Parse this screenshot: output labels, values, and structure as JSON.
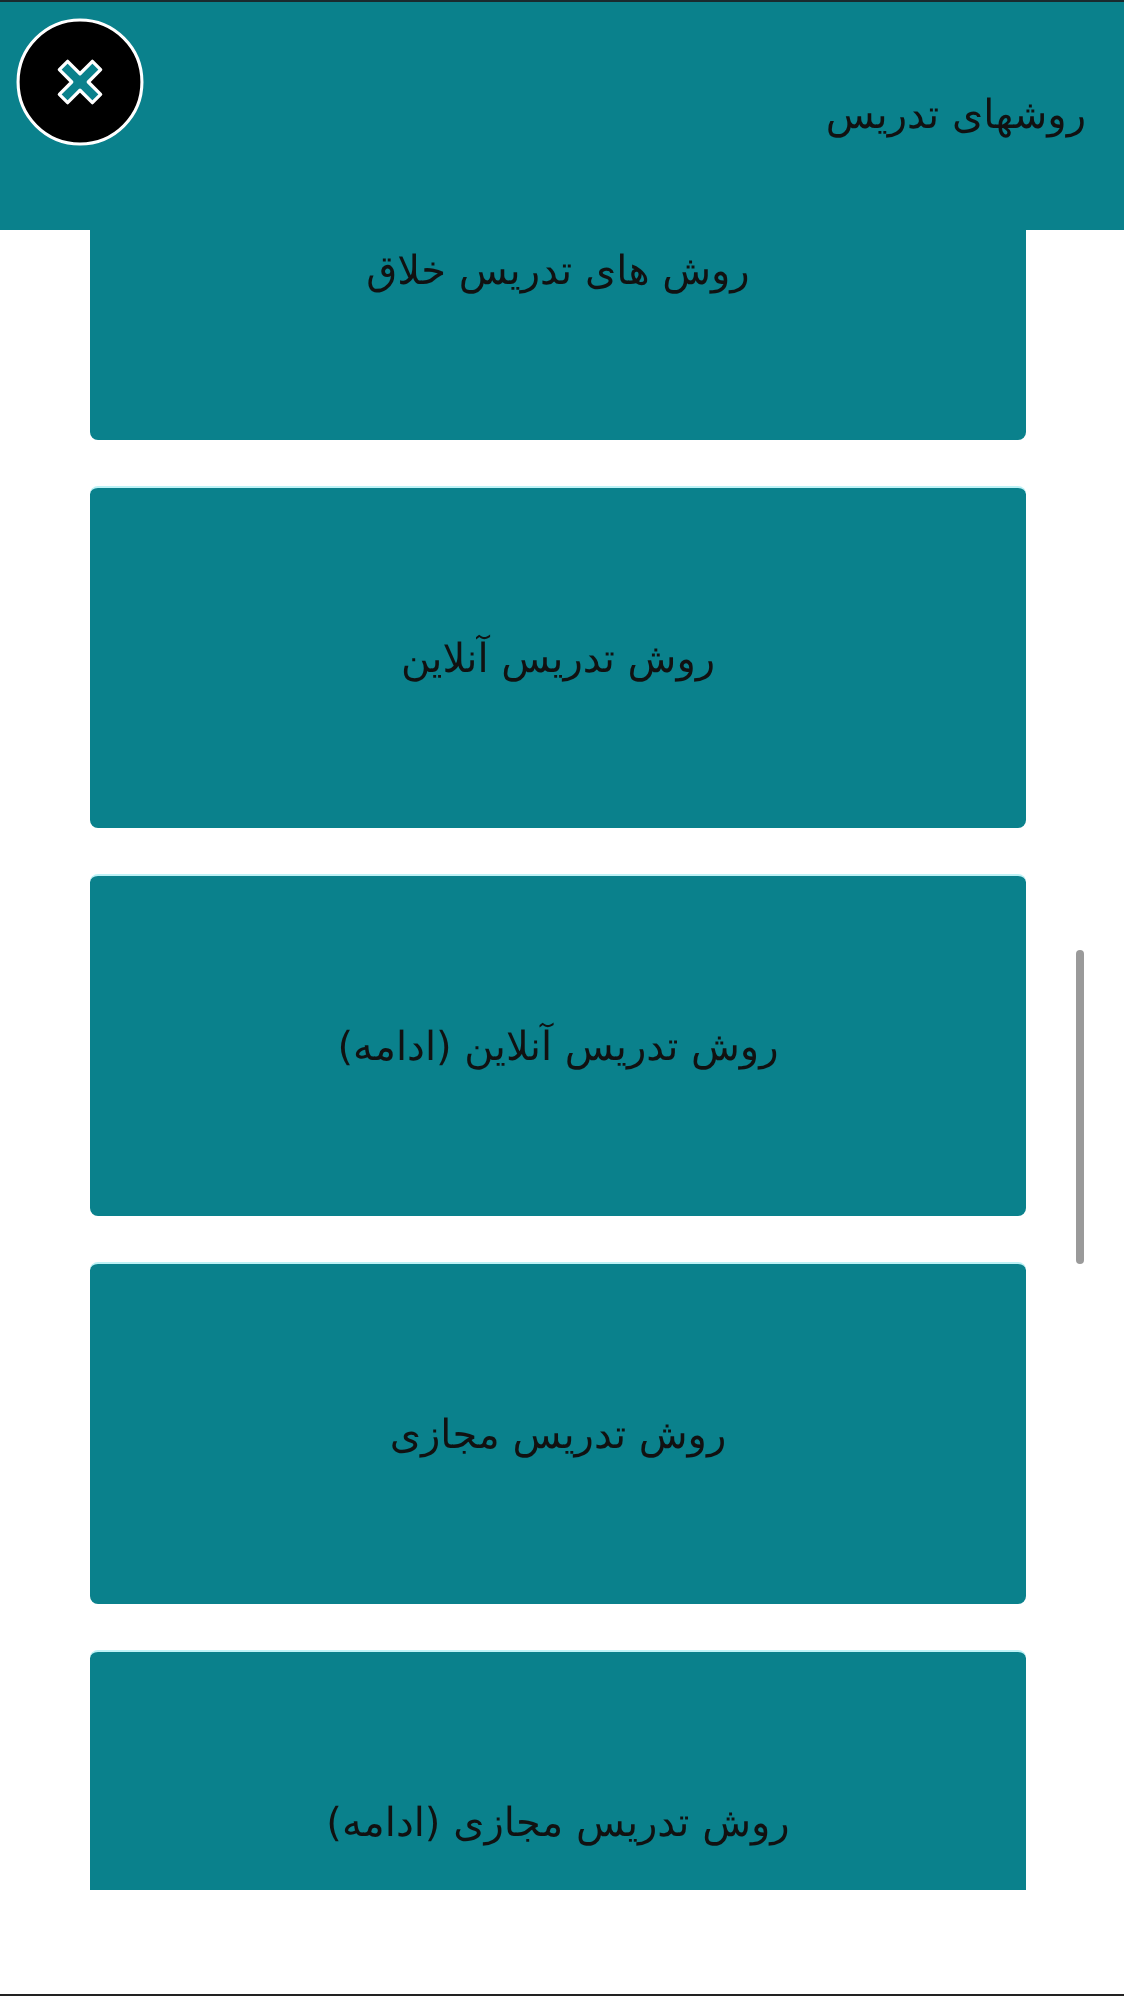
{
  "header": {
    "title": "روشهای تدریس"
  },
  "items": [
    {
      "label": "روش های تدریس خلاق"
    },
    {
      "label": "روش تدریس آنلاین"
    },
    {
      "label": "روش تدریس آنلاین (ادامه)"
    },
    {
      "label": "روش تدریس مجازی"
    },
    {
      "label": "روش تدریس مجازی (ادامه)"
    }
  ]
}
